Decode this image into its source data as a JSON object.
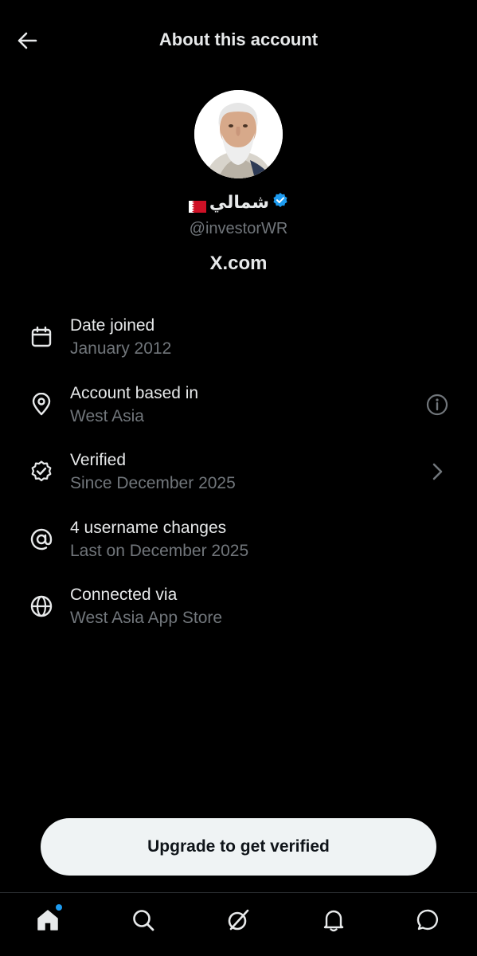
{
  "header": {
    "title": "About this account",
    "back_icon": "arrow-left-icon"
  },
  "profile": {
    "display_name": "شمالي",
    "flag": "bahrain-flag-icon",
    "verified_badge": "verified-check-icon",
    "handle": "@investorWR",
    "domain": "X.com"
  },
  "info": [
    {
      "icon": "calendar-icon",
      "label": "Date joined",
      "value": "January 2012"
    },
    {
      "icon": "location-pin-icon",
      "label": "Account based in",
      "value": "West Asia",
      "action": "info-icon"
    },
    {
      "icon": "verified-seal-icon",
      "label": "Verified",
      "value": "Since December 2025",
      "action": "chevron-right-icon"
    },
    {
      "icon": "at-sign-icon",
      "label": "4 username changes",
      "value": "Last on December 2025"
    },
    {
      "icon": "globe-icon",
      "label": "Connected via",
      "value": "West Asia App Store"
    }
  ],
  "upgrade_button": "Upgrade to get verified",
  "tabbar": {
    "tabs": [
      "home-icon",
      "search-icon",
      "grok-icon",
      "notifications-bell-icon",
      "messages-icon"
    ],
    "home_has_notification_dot": true
  },
  "colors": {
    "background": "#000000",
    "primary_text": "#e7e9ea",
    "secondary_text": "#71767b",
    "accent": "#1d9bf0",
    "button_bg": "#eff3f4",
    "flag_red": "#ce1126"
  }
}
